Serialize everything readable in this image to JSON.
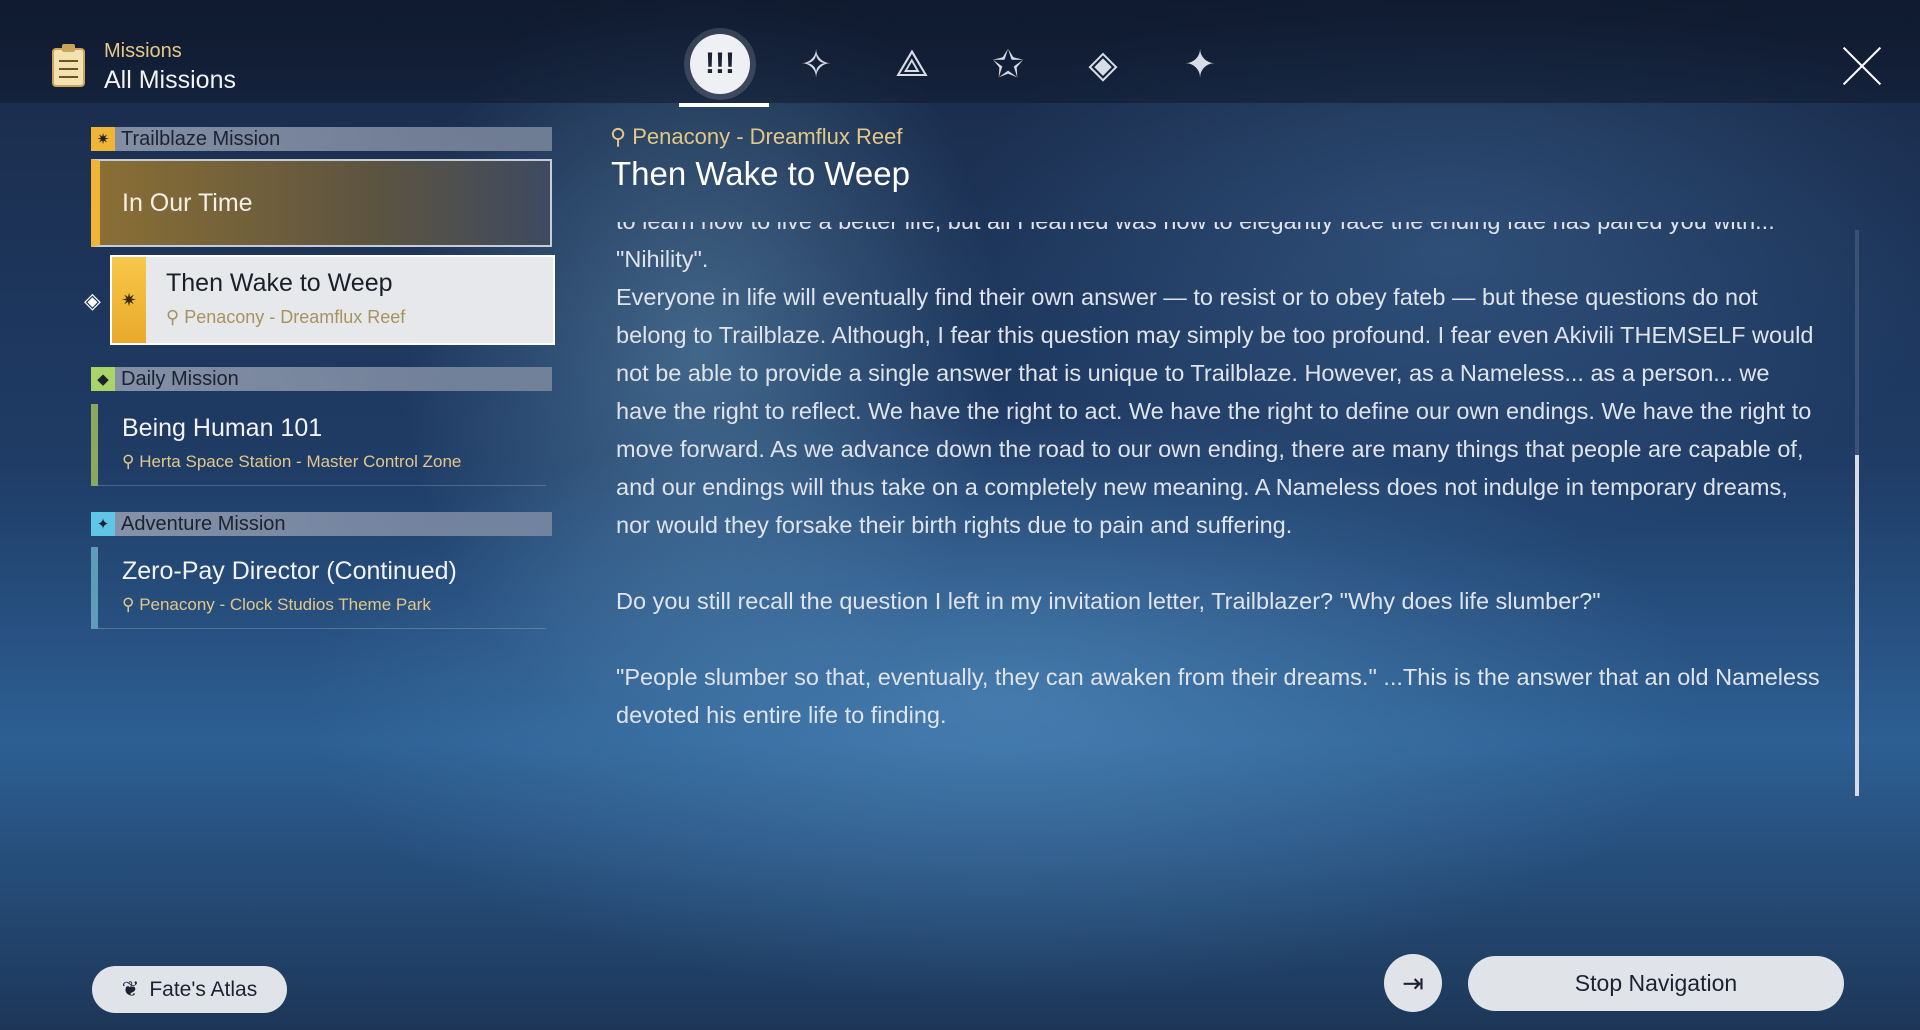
{
  "header": {
    "section": "Missions",
    "title": "All Missions"
  },
  "tabs": [
    {
      "icon": "all-missions-icon",
      "glyph": "!!!",
      "active": true
    },
    {
      "icon": "trailblaze-icon",
      "glyph": "✧"
    },
    {
      "icon": "companion-icon",
      "glyph": "⟁"
    },
    {
      "icon": "adventure-star-icon",
      "glyph": "✩"
    },
    {
      "icon": "daily-diamond-icon",
      "glyph": "◈"
    },
    {
      "icon": "event-icon",
      "glyph": "✦"
    }
  ],
  "sections": [
    {
      "label": "Trailblaze Mission",
      "color": "#f0b437"
    },
    {
      "label": "Daily Mission",
      "color": "#a8d46a"
    },
    {
      "label": "Adventure Mission",
      "color": "#5fc6e8"
    }
  ],
  "trailblaze": {
    "parent": "In Our Time",
    "child": {
      "title": "Then Wake to Weep",
      "location": "Penacony - Dreamflux Reef"
    }
  },
  "daily": [
    {
      "title": "Being Human 101",
      "location": "Herta Space Station - Master Control Zone"
    }
  ],
  "adventure": [
    {
      "title": "Zero-Pay Director (Continued)",
      "location": "Penacony - Clock Studios Theme Park"
    }
  ],
  "detail": {
    "location": "Penacony - Dreamflux Reef",
    "title": "Then Wake to Weep",
    "paragraphs": [
      "to learn how to live a better life, but all I learned was how to elegantly face the ending fate has paired you with... \"Nihility\".",
      "Everyone in life will eventually find their own answer — to resist or to obey fateb — but these questions do not belong to Trailblaze. Although, I fear this question may simply be too profound. I fear even Akivili THEMSELF would not be able to provide a single answer that is unique to Trailblaze. However, as a Nameless... as a person... we have the right to reflect. We have the right to act. We have the right to define our own endings. We have the right to move forward. As we advance down the road to our own ending, there are many things that people are capable of, and our endings will thus take on a completely new meaning. A Nameless does not indulge in temporary dreams, nor would they forsake their birth rights due to pain and suffering.",
      "Do you still recall the question I left in my invitation letter, Trailblazer? \"Why does life slumber?\"",
      "\"People slumber so that, eventually, they can awaken from their dreams.\" ...This is the answer that an old Nameless devoted his entire life to finding."
    ]
  },
  "footer": {
    "fates_atlas": "Fate's Atlas",
    "stop_navigation": "Stop Navigation"
  }
}
